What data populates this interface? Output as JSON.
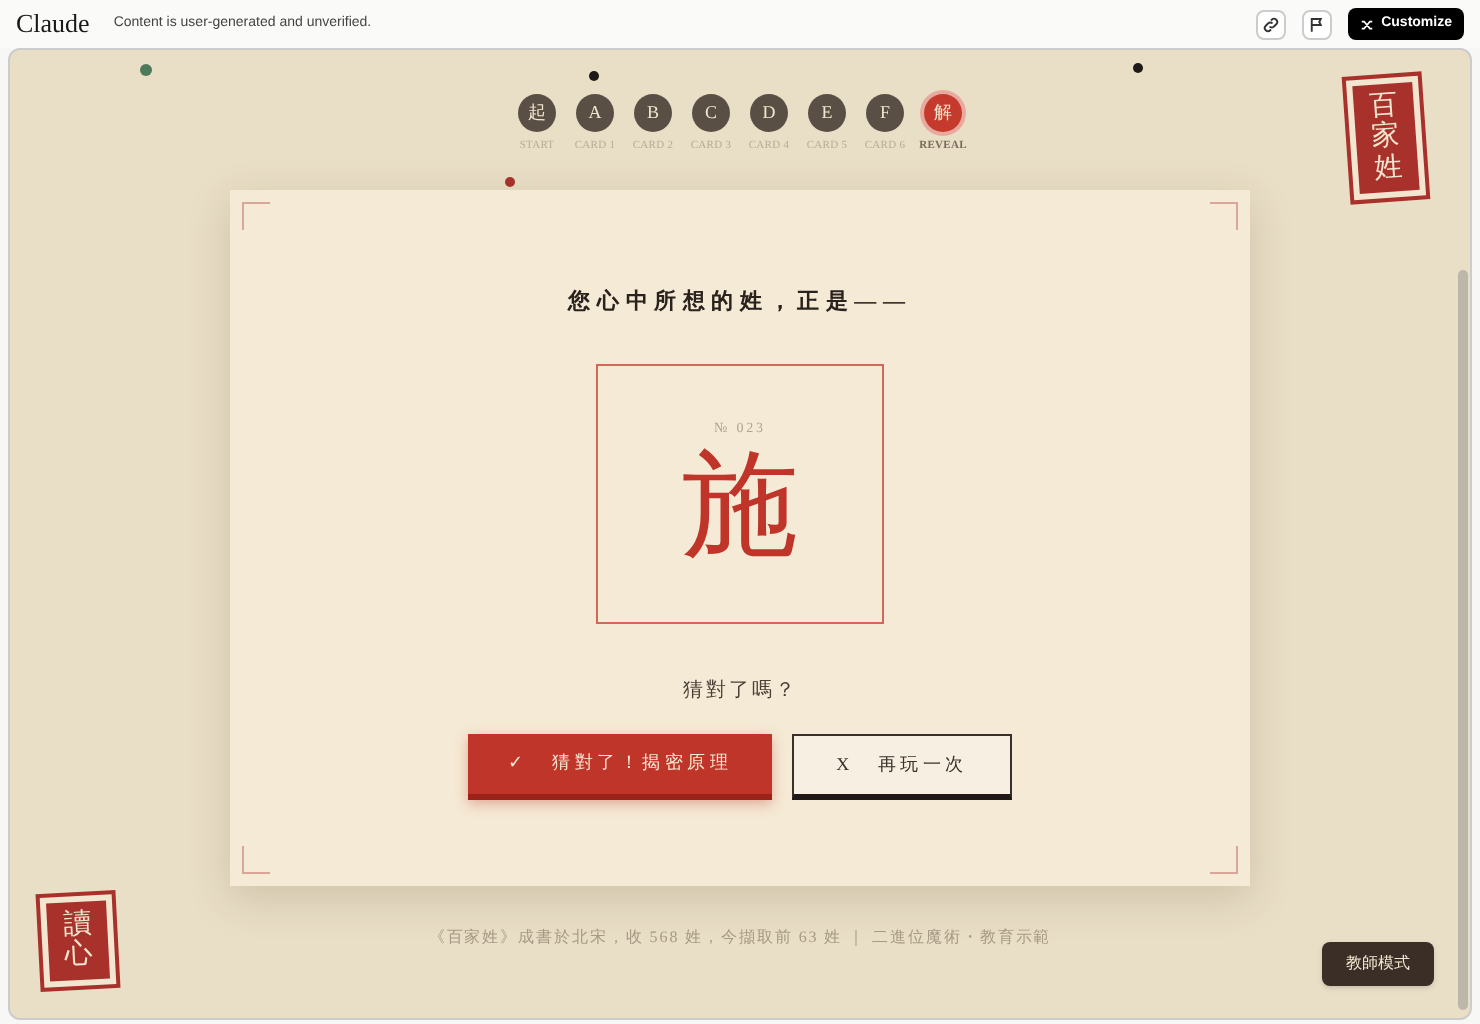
{
  "header": {
    "brand": "Claude",
    "notice": "Content is user-generated and unverified.",
    "customize": "Customize"
  },
  "stamps": [
    {
      "text": "百家姓"
    },
    {
      "text": "讀心"
    }
  ],
  "steps": [
    {
      "glyph": "起",
      "caption": "START",
      "selected": false
    },
    {
      "glyph": "A",
      "caption": "CARD 1",
      "selected": false
    },
    {
      "glyph": "B",
      "caption": "CARD 2",
      "selected": false
    },
    {
      "glyph": "C",
      "caption": "CARD 3",
      "selected": false
    },
    {
      "glyph": "D",
      "caption": "CARD 4",
      "selected": false
    },
    {
      "glyph": "E",
      "caption": "CARD 5",
      "selected": false
    },
    {
      "glyph": "F",
      "caption": "CARD 6",
      "selected": false
    },
    {
      "glyph": "解",
      "caption": "REVEAL",
      "selected": true
    }
  ],
  "card": {
    "prompt": "您心中所想的姓，正是——",
    "number": "№ 023",
    "surname": "施",
    "question": "猜對了嗎？",
    "buttons": [
      {
        "icon": "✓",
        "label": "猜對了！揭密原理",
        "kind": "primary"
      },
      {
        "icon": "X",
        "label": "再玩一次",
        "kind": "secondary"
      }
    ]
  },
  "footer": "《百家姓》成書於北宋，收 568 姓，今擷取前 63 姓 ｜ 二進位魔術・教育示範",
  "teacher_button": "教師模式"
}
